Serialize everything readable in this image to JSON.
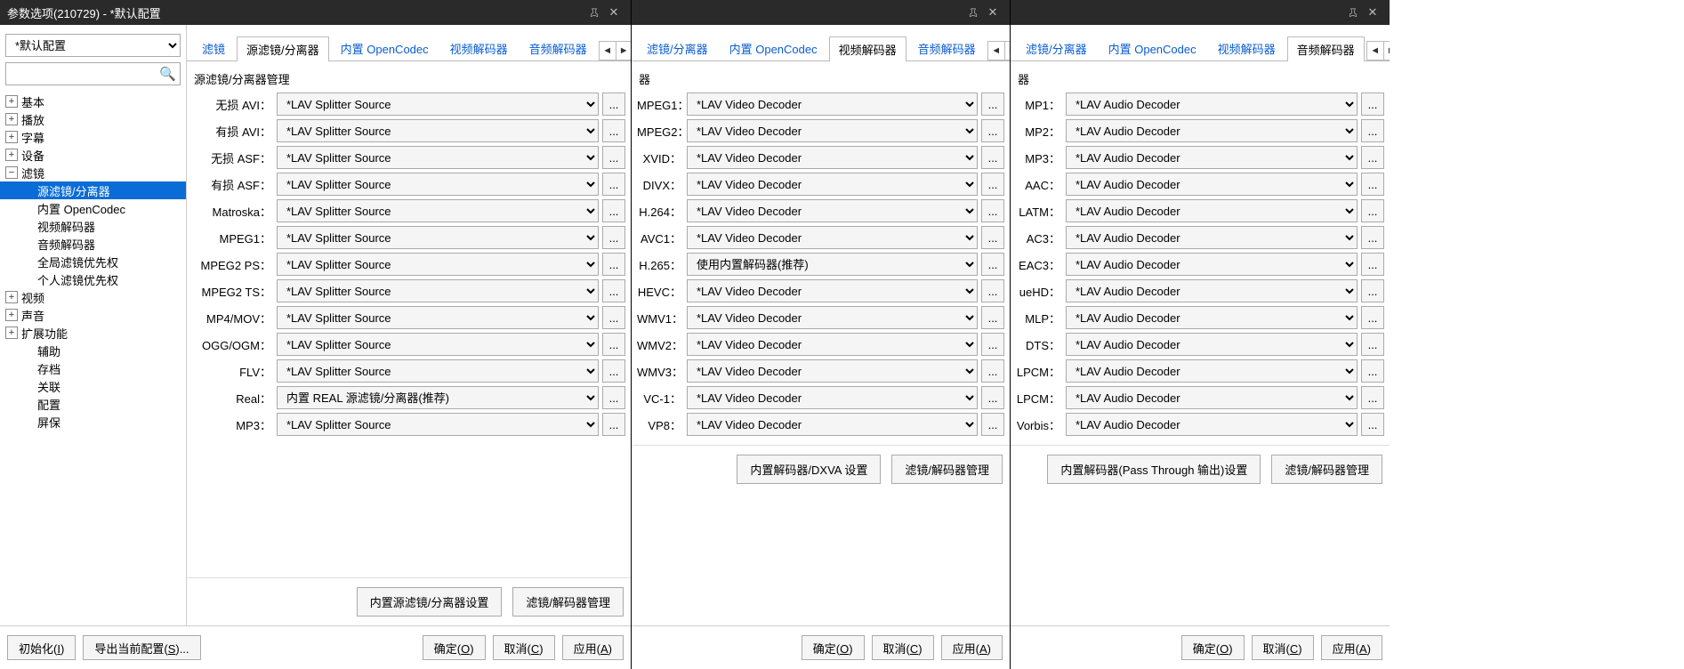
{
  "window": {
    "title": "参数选项(210729) - *默认配置",
    "pin_tooltip": "pin",
    "close_tooltip": "close"
  },
  "left": {
    "config_selected": "*默认配置",
    "search_placeholder": "",
    "tree": {
      "basic": "基本",
      "playback": "播放",
      "subtitle": "字幕",
      "device": "设备",
      "filter": "滤镜",
      "filter_children": {
        "source_splitter": "源滤镜/分离器",
        "opencodec": "内置 OpenCodec",
        "video_decoder": "视频解码器",
        "audio_decoder": "音频解码器",
        "global_priority": "全局滤镜优先权",
        "personal_priority": "个人滤镜优先权"
      },
      "video": "视频",
      "audio": "声音",
      "extensions": "扩展功能",
      "aux": "辅助",
      "archive": "存档",
      "assoc": "关联",
      "config": "配置",
      "screensaver": "屏保"
    }
  },
  "tabs_source": {
    "filter": "滤镜",
    "source_splitter": "源滤镜/分离器",
    "opencodec": "内置 OpenCodec",
    "video_decoder": "视频解码器",
    "audio_decoder": "音频解码器"
  },
  "pane1": {
    "section_title": "源滤镜/分离器管理",
    "rows": [
      {
        "label": "无损 AVI：",
        "value": "*LAV Splitter Source"
      },
      {
        "label": "有损 AVI：",
        "value": "*LAV Splitter Source"
      },
      {
        "label": "无损 ASF：",
        "value": "*LAV Splitter Source"
      },
      {
        "label": "有损 ASF：",
        "value": "*LAV Splitter Source"
      },
      {
        "label": "Matroska：",
        "value": "*LAV Splitter Source"
      },
      {
        "label": "MPEG1：",
        "value": "*LAV Splitter Source"
      },
      {
        "label": "MPEG2 PS：",
        "value": "*LAV Splitter Source"
      },
      {
        "label": "MPEG2 TS：",
        "value": "*LAV Splitter Source"
      },
      {
        "label": "MP4/MOV：",
        "value": "*LAV Splitter Source"
      },
      {
        "label": "OGG/OGM：",
        "value": "*LAV Splitter Source"
      },
      {
        "label": "FLV：",
        "value": "*LAV Splitter Source"
      },
      {
        "label": "Real：",
        "value": "内置 REAL 源滤镜/分离器(推荐)"
      },
      {
        "label": "MP3：",
        "value": "*LAV Splitter Source"
      }
    ],
    "btn_internal": "内置源滤镜/分离器设置",
    "btn_manage": "滤镜/解码器管理"
  },
  "pane2": {
    "tabs_prefix": "滤镜/分离器",
    "section_title": "器",
    "rows": [
      {
        "label": "MPEG1：",
        "value": "*LAV Video Decoder"
      },
      {
        "label": "MPEG2：",
        "value": "*LAV Video Decoder"
      },
      {
        "label": "XVID：",
        "value": "*LAV Video Decoder"
      },
      {
        "label": "DIVX：",
        "value": "*LAV Video Decoder"
      },
      {
        "label": "H.264：",
        "value": "*LAV Video Decoder"
      },
      {
        "label": "AVC1：",
        "value": "*LAV Video Decoder"
      },
      {
        "label": "H.265：",
        "value": "使用内置解码器(推荐)"
      },
      {
        "label": "HEVC：",
        "value": "*LAV Video Decoder"
      },
      {
        "label": "WMV1：",
        "value": "*LAV Video Decoder"
      },
      {
        "label": "WMV2：",
        "value": "*LAV Video Decoder"
      },
      {
        "label": "WMV3：",
        "value": "*LAV Video Decoder"
      },
      {
        "label": "VC-1：",
        "value": "*LAV Video Decoder"
      },
      {
        "label": "VP8：",
        "value": "*LAV Video Decoder"
      }
    ],
    "btn_internal": "内置解码器/DXVA 设置",
    "btn_manage": "滤镜/解码器管理"
  },
  "pane3": {
    "tabs_prefix": "滤镜/分离器",
    "section_title": "器",
    "rows": [
      {
        "label": "MP1：",
        "value": "*LAV Audio Decoder"
      },
      {
        "label": "MP2：",
        "value": "*LAV Audio Decoder"
      },
      {
        "label": "MP3：",
        "value": "*LAV Audio Decoder"
      },
      {
        "label": "AAC：",
        "value": "*LAV Audio Decoder"
      },
      {
        "label": "LATM：",
        "value": "*LAV Audio Decoder"
      },
      {
        "label": "AC3：",
        "value": "*LAV Audio Decoder"
      },
      {
        "label": "EAC3：",
        "value": "*LAV Audio Decoder"
      },
      {
        "label": "ueHD：",
        "value": "*LAV Audio Decoder"
      },
      {
        "label": "MLP：",
        "value": "*LAV Audio Decoder"
      },
      {
        "label": "DTS：",
        "value": "*LAV Audio Decoder"
      },
      {
        "label": "LPCM：",
        "value": "*LAV Audio Decoder"
      },
      {
        "label": "LPCM：",
        "value": "*LAV Audio Decoder"
      },
      {
        "label": "Vorbis：",
        "value": "*LAV Audio Decoder"
      }
    ],
    "btn_internal": "内置解码器(Pass Through 输出)设置",
    "btn_manage": "滤镜/解码器管理"
  },
  "footer": {
    "init": "初始化",
    "init_key": "I",
    "export": "导出当前配置",
    "export_key": "S",
    "ok": "确定",
    "ok_key": "O",
    "cancel": "取消",
    "cancel_key": "C",
    "apply": "应用",
    "apply_key": "A"
  }
}
